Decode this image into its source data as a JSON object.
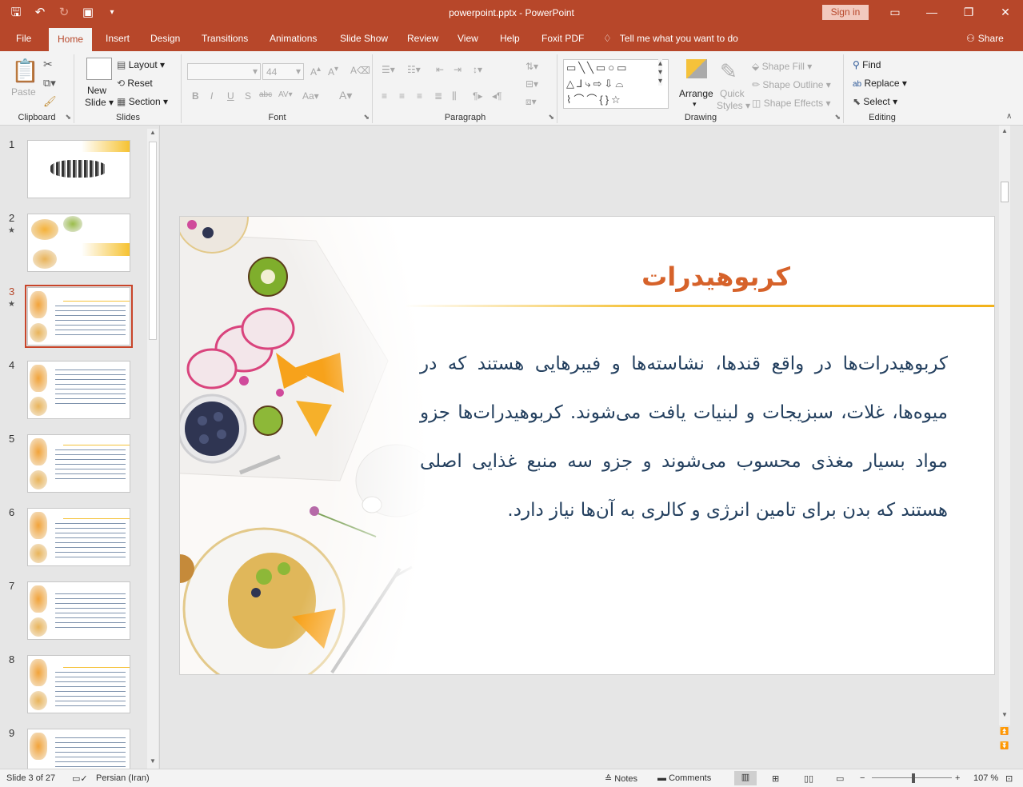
{
  "titlebar": {
    "title": "powerpoint.pptx  -  PowerPoint",
    "signin": "Sign in",
    "minimize": "—",
    "restore": "❐",
    "close": "✕",
    "ribbon_display": "▭"
  },
  "tabs": [
    "File",
    "Home",
    "Insert",
    "Design",
    "Transitions",
    "Animations",
    "Slide Show",
    "Review",
    "View",
    "Help",
    "Foxit PDF"
  ],
  "active_tab": "Home",
  "tell_me": "Tell me what you want to do",
  "share": "Share",
  "ribbon": {
    "clipboard": {
      "label": "Clipboard",
      "paste": "Paste"
    },
    "slides": {
      "label": "Slides",
      "new_slide_1": "New",
      "new_slide_2": "Slide",
      "layout": "Layout",
      "reset": "Reset",
      "section": "Section"
    },
    "font": {
      "label": "Font",
      "size": "44"
    },
    "paragraph": {
      "label": "Paragraph"
    },
    "drawing": {
      "label": "Drawing",
      "arrange": "Arrange",
      "quick_1": "Quick",
      "quick_2": "Styles",
      "shape_fill": "Shape Fill",
      "shape_outline": "Shape Outline",
      "shape_effects": "Shape Effects"
    },
    "editing": {
      "label": "Editing",
      "find": "Find",
      "replace": "Replace",
      "select": "Select"
    }
  },
  "thumbnails": [
    {
      "num": "1",
      "star": false
    },
    {
      "num": "2",
      "star": true
    },
    {
      "num": "3",
      "star": true,
      "selected": true
    },
    {
      "num": "4",
      "star": false
    },
    {
      "num": "5",
      "star": false
    },
    {
      "num": "6",
      "star": false
    },
    {
      "num": "7",
      "star": false
    },
    {
      "num": "8",
      "star": false
    },
    {
      "num": "9",
      "star": false
    }
  ],
  "slide": {
    "title": "کربوهیدرات",
    "body": "کربوهیدرات‌ها در واقع قندها، نشاسته‌ها و فیبرهایی هستند که در میوه‌ها، غلات، سبزیجات و لبنیات یافت می‌شوند. کربوهیدرات‌ها جزو مواد بسیار مغذی محسوب می‌شوند و جزو سه منبع غذایی اصلی هستند که بدن برای تامین انرژی و کالری به آن‌ها نیاز دارد."
  },
  "status": {
    "slide_info": "Slide 3 of 27",
    "language": "Persian (Iran)",
    "notes": "Notes",
    "comments": "Comments",
    "zoom": "107 %"
  },
  "colors": {
    "accent": "#b7472a",
    "title_orange": "#d6622a",
    "body_blue": "#24405f",
    "line_yellow": "#f5c23a"
  }
}
